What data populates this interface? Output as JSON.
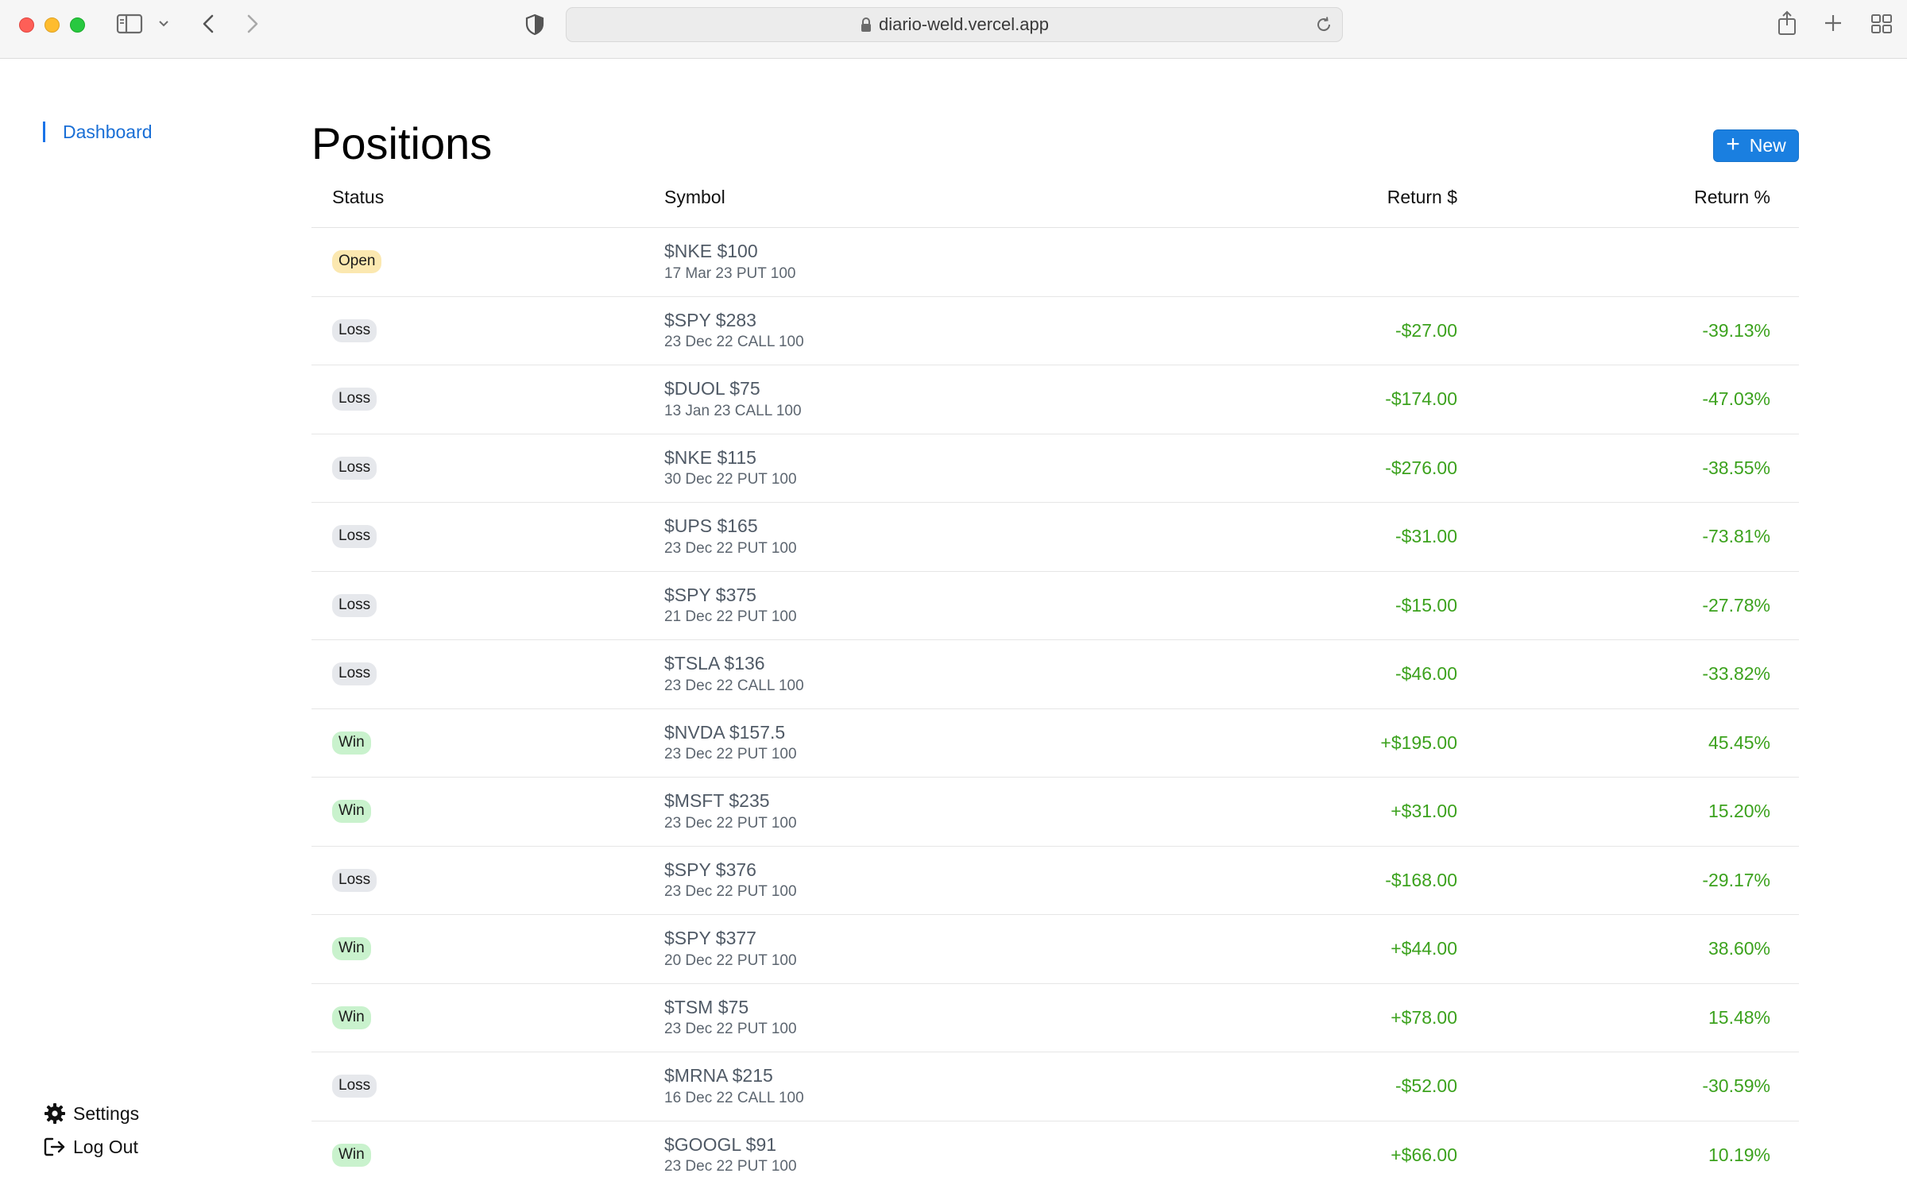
{
  "browser": {
    "url": "diario-weld.vercel.app"
  },
  "sidebar": {
    "nav": [
      {
        "label": "Dashboard",
        "active": true
      }
    ],
    "settings_label": "Settings",
    "logout_label": "Log Out"
  },
  "main": {
    "title": "Positions",
    "new_button_label": "New",
    "columns": {
      "status": "Status",
      "symbol": "Symbol",
      "return_dollar": "Return $",
      "return_pct": "Return %"
    },
    "rows": [
      {
        "status": "Open",
        "symbol": "$NKE $100",
        "details": "17 Mar 23 PUT 100",
        "return_dollar": "",
        "return_pct": ""
      },
      {
        "status": "Loss",
        "symbol": "$SPY $283",
        "details": "23 Dec 22 CALL 100",
        "return_dollar": "-$27.00",
        "return_pct": "-39.13%"
      },
      {
        "status": "Loss",
        "symbol": "$DUOL $75",
        "details": "13 Jan 23 CALL 100",
        "return_dollar": "-$174.00",
        "return_pct": "-47.03%"
      },
      {
        "status": "Loss",
        "symbol": "$NKE $115",
        "details": "30 Dec 22 PUT 100",
        "return_dollar": "-$276.00",
        "return_pct": "-38.55%"
      },
      {
        "status": "Loss",
        "symbol": "$UPS $165",
        "details": "23 Dec 22 PUT 100",
        "return_dollar": "-$31.00",
        "return_pct": "-73.81%"
      },
      {
        "status": "Loss",
        "symbol": "$SPY $375",
        "details": "21 Dec 22 PUT 100",
        "return_dollar": "-$15.00",
        "return_pct": "-27.78%"
      },
      {
        "status": "Loss",
        "symbol": "$TSLA $136",
        "details": "23 Dec 22 CALL 100",
        "return_dollar": "-$46.00",
        "return_pct": "-33.82%"
      },
      {
        "status": "Win",
        "symbol": "$NVDA $157.5",
        "details": "23 Dec 22 PUT 100",
        "return_dollar": "+$195.00",
        "return_pct": "45.45%"
      },
      {
        "status": "Win",
        "symbol": "$MSFT $235",
        "details": "23 Dec 22 PUT 100",
        "return_dollar": "+$31.00",
        "return_pct": "15.20%"
      },
      {
        "status": "Loss",
        "symbol": "$SPY $376",
        "details": "23 Dec 22 PUT 100",
        "return_dollar": "-$168.00",
        "return_pct": "-29.17%"
      },
      {
        "status": "Win",
        "symbol": "$SPY $377",
        "details": "20 Dec 22 PUT 100",
        "return_dollar": "+$44.00",
        "return_pct": "38.60%"
      },
      {
        "status": "Win",
        "symbol": "$TSM $75",
        "details": "23 Dec 22 PUT 100",
        "return_dollar": "+$78.00",
        "return_pct": "15.48%"
      },
      {
        "status": "Loss",
        "symbol": "$MRNA $215",
        "details": "16 Dec 22 CALL 100",
        "return_dollar": "-$52.00",
        "return_pct": "-30.59%"
      },
      {
        "status": "Win",
        "symbol": "$GOOGL $91",
        "details": "23 Dec 22 PUT 100",
        "return_dollar": "+$66.00",
        "return_pct": "10.19%"
      }
    ]
  },
  "colors": {
    "accent": "#1a7fe0",
    "positive_text": "#3ca21e",
    "badge_open": "#fbe8b0",
    "badge_loss": "#e6e8ec",
    "badge_win": "#c9f2cd"
  },
  "icons": [
    "sidebar-toggle-icon",
    "chevron-down-icon",
    "back-arrow-icon",
    "forward-arrow-icon",
    "shield-icon",
    "lock-icon",
    "reload-icon",
    "share-icon",
    "new-tab-plus-icon",
    "tab-overview-icon",
    "gear-icon",
    "logout-icon",
    "plus-icon"
  ]
}
